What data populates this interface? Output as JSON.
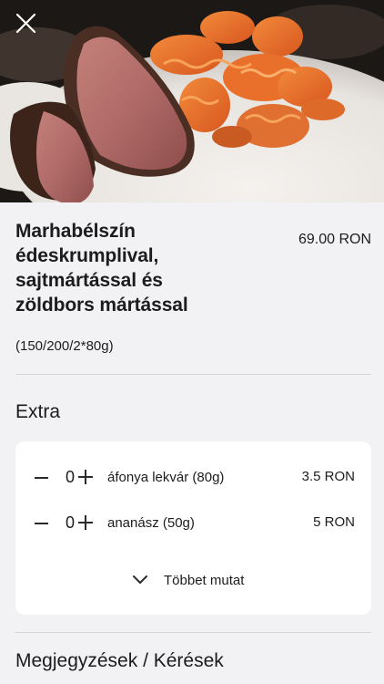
{
  "header": {
    "close_icon": "close-icon",
    "image": "steak-with-sweet-potato-chips-photo"
  },
  "product": {
    "title_lines": [
      "Marhabélszín",
      "édeskrumplival,",
      "sajtmártással és",
      "zöldbors mártással"
    ],
    "price": "69.00 RON",
    "portion": "(150/200/2*80g)"
  },
  "extra": {
    "section_title": "Extra",
    "items": [
      {
        "minus_icon": "minus-icon",
        "quantity": "0",
        "plus_icon": "plus-icon",
        "name": "áfonya lekvár (80g)",
        "price": "3.5 RON"
      },
      {
        "minus_icon": "minus-icon",
        "quantity": "0",
        "plus_icon": "plus-icon",
        "name": "ananász (50g)",
        "price": "5 RON"
      }
    ],
    "more_icon": "chevron-down-icon",
    "more_label": "Többet mutat"
  },
  "notes": {
    "section_title": "Megjegyzések / Kérések"
  },
  "colors": {
    "background": "#f2f2f4",
    "card": "#ffffff",
    "text": "#1c1c1e",
    "divider": "#d6d6d9"
  }
}
